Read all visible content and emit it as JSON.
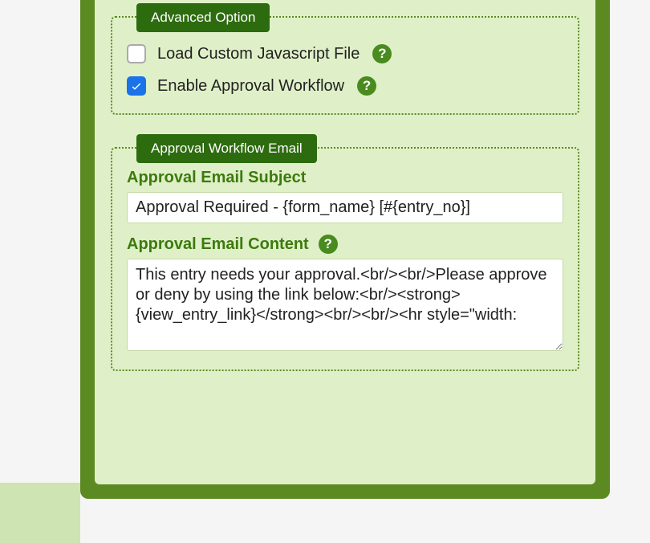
{
  "advanced": {
    "legend": "Advanced Option",
    "load_js_label": "Load Custom Javascript File",
    "load_js_checked": false,
    "enable_approval_label": "Enable Approval Workflow",
    "enable_approval_checked": true
  },
  "approval_email": {
    "legend": "Approval Workflow Email",
    "subject_label": "Approval Email Subject",
    "subject_value": "Approval Required - {form_name} [#{entry_no}]",
    "content_label": "Approval Email Content",
    "content_value": "This entry needs your approval.<br/><br/>Please approve or deny by using the link below:<br/><strong>{view_entry_link}</strong><br/><br/><hr style=\"width:"
  },
  "help_glyph": "?"
}
